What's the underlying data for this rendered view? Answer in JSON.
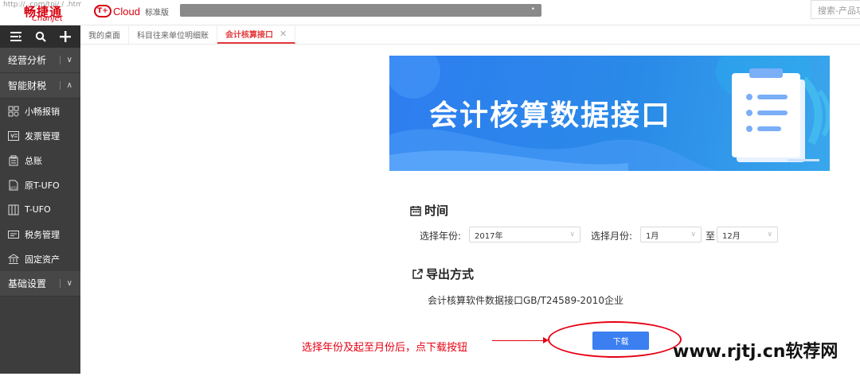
{
  "header": {
    "url_fragment": "http://  .com/tpi/  /  .html",
    "brand_logo": "畅捷通",
    "brand_sub": "Chanjet",
    "cloud_mark": "T+",
    "cloud_name": "Cloud",
    "edition": "标准版",
    "search_placeholder": "搜索-产品功能"
  },
  "sidebar": {
    "tools": {
      "menu_icon": "menu-icon",
      "search_icon": "search-icon",
      "add_icon": "plus-icon"
    },
    "groups": [
      {
        "label": "经营分析",
        "chevron": "∨"
      },
      {
        "label": "智能财税",
        "chevron": "∧"
      }
    ],
    "items": [
      {
        "label": "小畅报销",
        "icon": "expense-icon"
      },
      {
        "label": "发票管理",
        "icon": "invoice-icon"
      },
      {
        "label": "总账",
        "icon": "ledger-icon"
      },
      {
        "label": "原T-UFO",
        "icon": "ufo-report-icon"
      },
      {
        "label": "T-UFO",
        "icon": "report-icon"
      },
      {
        "label": "税务管理",
        "icon": "tax-icon"
      },
      {
        "label": "固定资产",
        "icon": "asset-icon"
      }
    ],
    "bottom_group": {
      "label": "基础设置",
      "chevron": "∨"
    }
  },
  "tabs": [
    {
      "label": "我的桌面",
      "active": false
    },
    {
      "label": "科目往来单位明细账",
      "active": false
    },
    {
      "label": "会计核算接口",
      "active": true,
      "close": "✕"
    }
  ],
  "banner": {
    "title": "会计核算数据接口"
  },
  "time_section": {
    "heading": "时间",
    "year_label": "选择年份:",
    "year_value": "2017年",
    "month_label": "选择月份:",
    "month_from": "1月",
    "to_label": "至",
    "month_to": "12月"
  },
  "export_section": {
    "heading": "导出方式",
    "standard": "会计核算软件数据接口GB/T24589-2010企业"
  },
  "download_button": "下载",
  "annotation": "选择年份及起至月份后，点下载按钮",
  "watermark": "www.rjtj.cn软荐网",
  "colors": {
    "sidebar_bg": "#3d3d3d",
    "accent_red": "#e4393c",
    "primary_blue": "#3c7ff0",
    "annotation_red": "#e60012"
  }
}
